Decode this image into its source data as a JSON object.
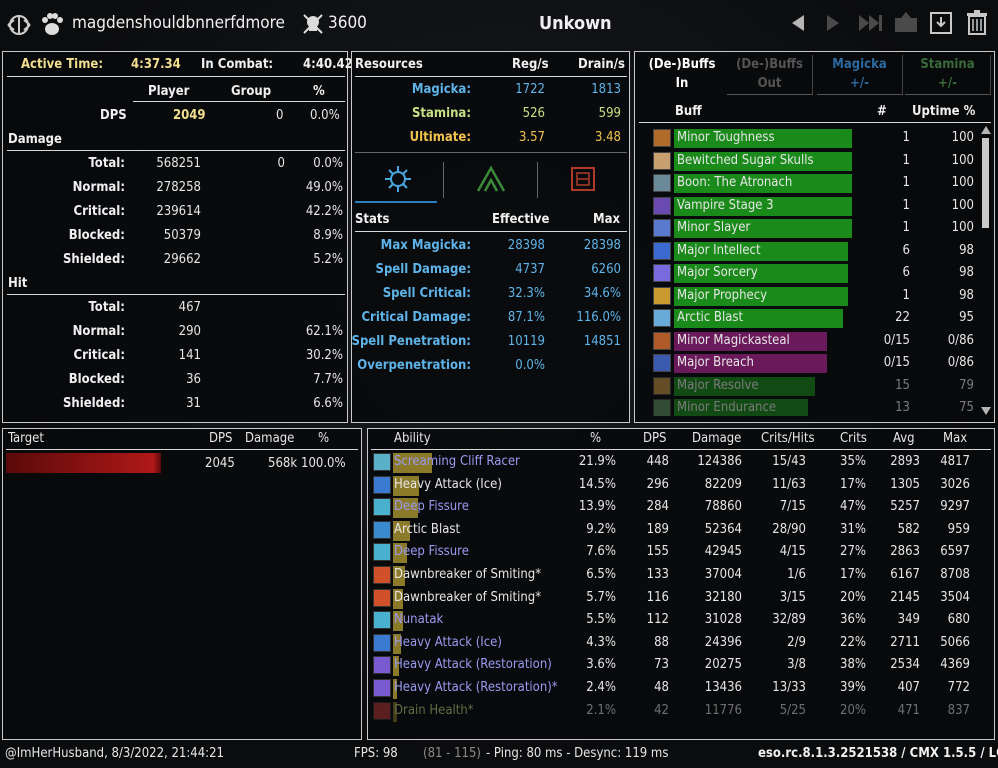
{
  "header": {
    "player_name": "magdenshouldbnnerfdmore",
    "score": "3600",
    "target_name": "Unkown"
  },
  "left": {
    "active_time_label": "Active Time:",
    "active_time": "4:37.34",
    "in_combat_label": "In Combat:",
    "in_combat": "4:40.42",
    "col_player": "Player",
    "col_group": "Group",
    "col_pct": "%",
    "dps_label": "DPS",
    "dps_player": "2049",
    "dps_group": "0",
    "dps_pct": "0.0%",
    "damage_section": "Damage",
    "damage_rows": [
      {
        "label": "Total:",
        "player": "568251",
        "group": "0",
        "pct": "0.0%"
      },
      {
        "label": "Normal:",
        "player": "278258",
        "group": "",
        "pct": "49.0%"
      },
      {
        "label": "Critical:",
        "player": "239614",
        "group": "",
        "pct": "42.2%"
      },
      {
        "label": "Blocked:",
        "player": "50379",
        "group": "",
        "pct": "8.9%"
      },
      {
        "label": "Shielded:",
        "player": "29662",
        "group": "",
        "pct": "5.2%"
      }
    ],
    "hit_section": "Hit",
    "hit_rows": [
      {
        "label": "Total:",
        "player": "467",
        "pct": ""
      },
      {
        "label": "Normal:",
        "player": "290",
        "pct": "62.1%"
      },
      {
        "label": "Critical:",
        "player": "141",
        "pct": "30.2%"
      },
      {
        "label": "Blocked:",
        "player": "36",
        "pct": "7.7%"
      },
      {
        "label": "Shielded:",
        "player": "31",
        "pct": "6.6%"
      }
    ]
  },
  "resources": {
    "title": "Resources",
    "col_reg": "Reg/s",
    "col_drain": "Drain/s",
    "rows": [
      {
        "label": "Magicka:",
        "reg": "1722",
        "drain": "1813",
        "color": "#5fb3e8"
      },
      {
        "label": "Stamina:",
        "reg": "526",
        "drain": "599",
        "color": "#c6e083"
      },
      {
        "label": "Ultimate:",
        "reg": "3.57",
        "drain": "3.48",
        "color": "#f0c24e"
      }
    ],
    "tabs": [
      "magicka-tab-icon",
      "stamina-tab-icon",
      "health-tab-icon"
    ]
  },
  "stats": {
    "title": "Stats",
    "col_eff": "Effective",
    "col_max": "Max",
    "rows": [
      {
        "label": "Max Magicka:",
        "eff": "28398",
        "max": "28398"
      },
      {
        "label": "Spell Damage:",
        "eff": "4737",
        "max": "6260"
      },
      {
        "label": "Spell Critical:",
        "eff": "32.3%",
        "max": "34.6%"
      },
      {
        "label": "Critical Damage:",
        "eff": "87.1%",
        "max": "116.0%"
      },
      {
        "label": "Spell Penetration:",
        "eff": "10119",
        "max": "14851"
      },
      {
        "label": "Overpenetration:",
        "eff": "0.0%",
        "max": ""
      }
    ]
  },
  "buffs": {
    "tabs": [
      {
        "label": "(De-)Buffs\nIn"
      },
      {
        "label": "(De-)Buffs\nOut"
      },
      {
        "label": "Magicka\n+/-"
      },
      {
        "label": "Stamina\n+/-"
      }
    ],
    "col_buff": "Buff",
    "col_count": "#",
    "col_uptime": "Uptime %",
    "rows": [
      {
        "name": "Minor Toughness",
        "count": "1",
        "uptime": "100",
        "color": "#1a8a1a",
        "fill": 1.0,
        "icon": "#b06a2a"
      },
      {
        "name": "Bewitched Sugar Skulls",
        "count": "1",
        "uptime": "100",
        "color": "#1a8a1a",
        "fill": 1.0,
        "icon": "#c8a070"
      },
      {
        "name": "Boon: The Atronach",
        "count": "1",
        "uptime": "100",
        "color": "#1a8a1a",
        "fill": 1.0,
        "icon": "#6a8a9a"
      },
      {
        "name": "Vampire Stage 3",
        "count": "1",
        "uptime": "100",
        "color": "#1a8a1a",
        "fill": 1.0,
        "icon": "#6a4ab0"
      },
      {
        "name": "Minor Slayer",
        "count": "1",
        "uptime": "100",
        "color": "#1a8a1a",
        "fill": 1.0,
        "icon": "#5a7ad0"
      },
      {
        "name": "Major Intellect",
        "count": "6",
        "uptime": "98",
        "color": "#1a8a1a",
        "fill": 0.98,
        "icon": "#3a6ad0"
      },
      {
        "name": "Major Sorcery",
        "count": "6",
        "uptime": "98",
        "color": "#1a8a1a",
        "fill": 0.98,
        "icon": "#7a6ae0"
      },
      {
        "name": "Major Prophecy",
        "count": "1",
        "uptime": "98",
        "color": "#1a8a1a",
        "fill": 0.98,
        "icon": "#c89a30"
      },
      {
        "name": "Arctic Blast",
        "count": "22",
        "uptime": "95",
        "color": "#1a8a1a",
        "fill": 0.95,
        "icon": "#6aaad8"
      },
      {
        "name": "Minor Magickasteal",
        "count": "0/15",
        "uptime": "0/86",
        "color": "#6a1a5a",
        "fill": 0.86,
        "icon": "#b05a2a"
      },
      {
        "name": "Major Breach",
        "count": "0/15",
        "uptime": "0/86",
        "color": "#6a1a5a",
        "fill": 0.86,
        "icon": "#3a5ab0"
      },
      {
        "name": "Major Resolve",
        "count": "15",
        "uptime": "79",
        "color": "#1a8a1a",
        "fill": 0.79,
        "icon": "#c09040",
        "dim": true
      },
      {
        "name": "Minor Endurance",
        "count": "13",
        "uptime": "75",
        "color": "#1a8a1a",
        "fill": 0.75,
        "icon": "#5a8a5a",
        "dim": true
      }
    ]
  },
  "targets": {
    "col_target": "Target",
    "col_dps": "DPS",
    "col_damage": "Damage",
    "col_pct": "%",
    "rows": [
      {
        "name": "",
        "dps": "2045",
        "damage": "568k",
        "pct": "100.0%"
      }
    ]
  },
  "abilities": {
    "col_ability": "Ability",
    "col_pct": "%",
    "col_dps": "DPS",
    "col_damage": "Damage",
    "col_crits_hits": "Crits/Hits",
    "col_crits": "Crits",
    "col_avg": "Avg",
    "col_max": "Max",
    "rows": [
      {
        "name": "Screaming Cliff Racer",
        "pct": "21.9%",
        "dps": "448",
        "damage": "124386",
        "ch": "15/43",
        "crits": "35%",
        "avg": "2893",
        "max": "4817",
        "color": "#9a9af0",
        "fill": 0.219,
        "icon": "#5ab0c8"
      },
      {
        "name": "Heavy Attack (Ice)",
        "pct": "14.5%",
        "dps": "296",
        "damage": "82209",
        "ch": "11/63",
        "crits": "17%",
        "avg": "1305",
        "max": "3026",
        "color": "#e6e6e6",
        "fill": 0.145,
        "icon": "#3a7ad0"
      },
      {
        "name": "Deep Fissure",
        "pct": "13.9%",
        "dps": "284",
        "damage": "78860",
        "ch": "7/15",
        "crits": "47%",
        "avg": "5257",
        "max": "9297",
        "color": "#9a9af0",
        "fill": 0.139,
        "icon": "#4ab0d0"
      },
      {
        "name": "Arctic Blast",
        "pct": "9.2%",
        "dps": "189",
        "damage": "52364",
        "ch": "28/90",
        "crits": "31%",
        "avg": "582",
        "max": "959",
        "color": "#e6e6e6",
        "fill": 0.092,
        "icon": "#3a8ad0"
      },
      {
        "name": "Deep Fissure",
        "pct": "7.6%",
        "dps": "155",
        "damage": "42945",
        "ch": "4/15",
        "crits": "27%",
        "avg": "2863",
        "max": "6597",
        "color": "#9a9af0",
        "fill": 0.076,
        "icon": "#4ab0d0"
      },
      {
        "name": "Dawnbreaker of Smiting*",
        "pct": "6.5%",
        "dps": "133",
        "damage": "37004",
        "ch": "1/6",
        "crits": "17%",
        "avg": "6167",
        "max": "8708",
        "color": "#e6e6e6",
        "fill": 0.065,
        "icon": "#d0502a"
      },
      {
        "name": "Dawnbreaker of Smiting*",
        "pct": "5.7%",
        "dps": "116",
        "damage": "32180",
        "ch": "3/15",
        "crits": "20%",
        "avg": "2145",
        "max": "3504",
        "color": "#e6e6e6",
        "fill": 0.057,
        "icon": "#d0502a"
      },
      {
        "name": "Nunatak",
        "pct": "5.5%",
        "dps": "112",
        "damage": "31028",
        "ch": "32/89",
        "crits": "36%",
        "avg": "349",
        "max": "680",
        "color": "#9a9af0",
        "fill": 0.055,
        "icon": "#4ab0d0"
      },
      {
        "name": "Heavy Attack (Ice)",
        "pct": "4.3%",
        "dps": "88",
        "damage": "24396",
        "ch": "2/9",
        "crits": "22%",
        "avg": "2711",
        "max": "5066",
        "color": "#9a9af0",
        "fill": 0.043,
        "icon": "#3a7ad0"
      },
      {
        "name": "Heavy Attack (Restoration)",
        "pct": "3.6%",
        "dps": "73",
        "damage": "20275",
        "ch": "3/8",
        "crits": "38%",
        "avg": "2534",
        "max": "4369",
        "color": "#9a9af0",
        "fill": 0.036,
        "icon": "#7a5ad0"
      },
      {
        "name": "Heavy Attack (Restoration)*",
        "pct": "2.4%",
        "dps": "48",
        "damage": "13436",
        "ch": "13/33",
        "crits": "39%",
        "avg": "407",
        "max": "772",
        "color": "#9a9af0",
        "fill": 0.024,
        "icon": "#7a5ad0"
      },
      {
        "name": "Drain Health*",
        "pct": "2.1%",
        "dps": "42",
        "damage": "11776",
        "ch": "5/25",
        "crits": "20%",
        "avg": "471",
        "max": "837",
        "color": "#c6e083",
        "fill": 0.021,
        "icon": "#c03a3a",
        "dim": true
      }
    ]
  },
  "footer": {
    "left": "@ImHerHusband, 8/3/2022, 21:44:21",
    "fps_label": "FPS: 98",
    "fps_range": "(81 - 115)",
    "ping": "- Ping: 80 ms - Desync: 119 ms",
    "version": "eso.rc.8.1.3.2521538 / CMX 1.5.5 / LC 61"
  }
}
